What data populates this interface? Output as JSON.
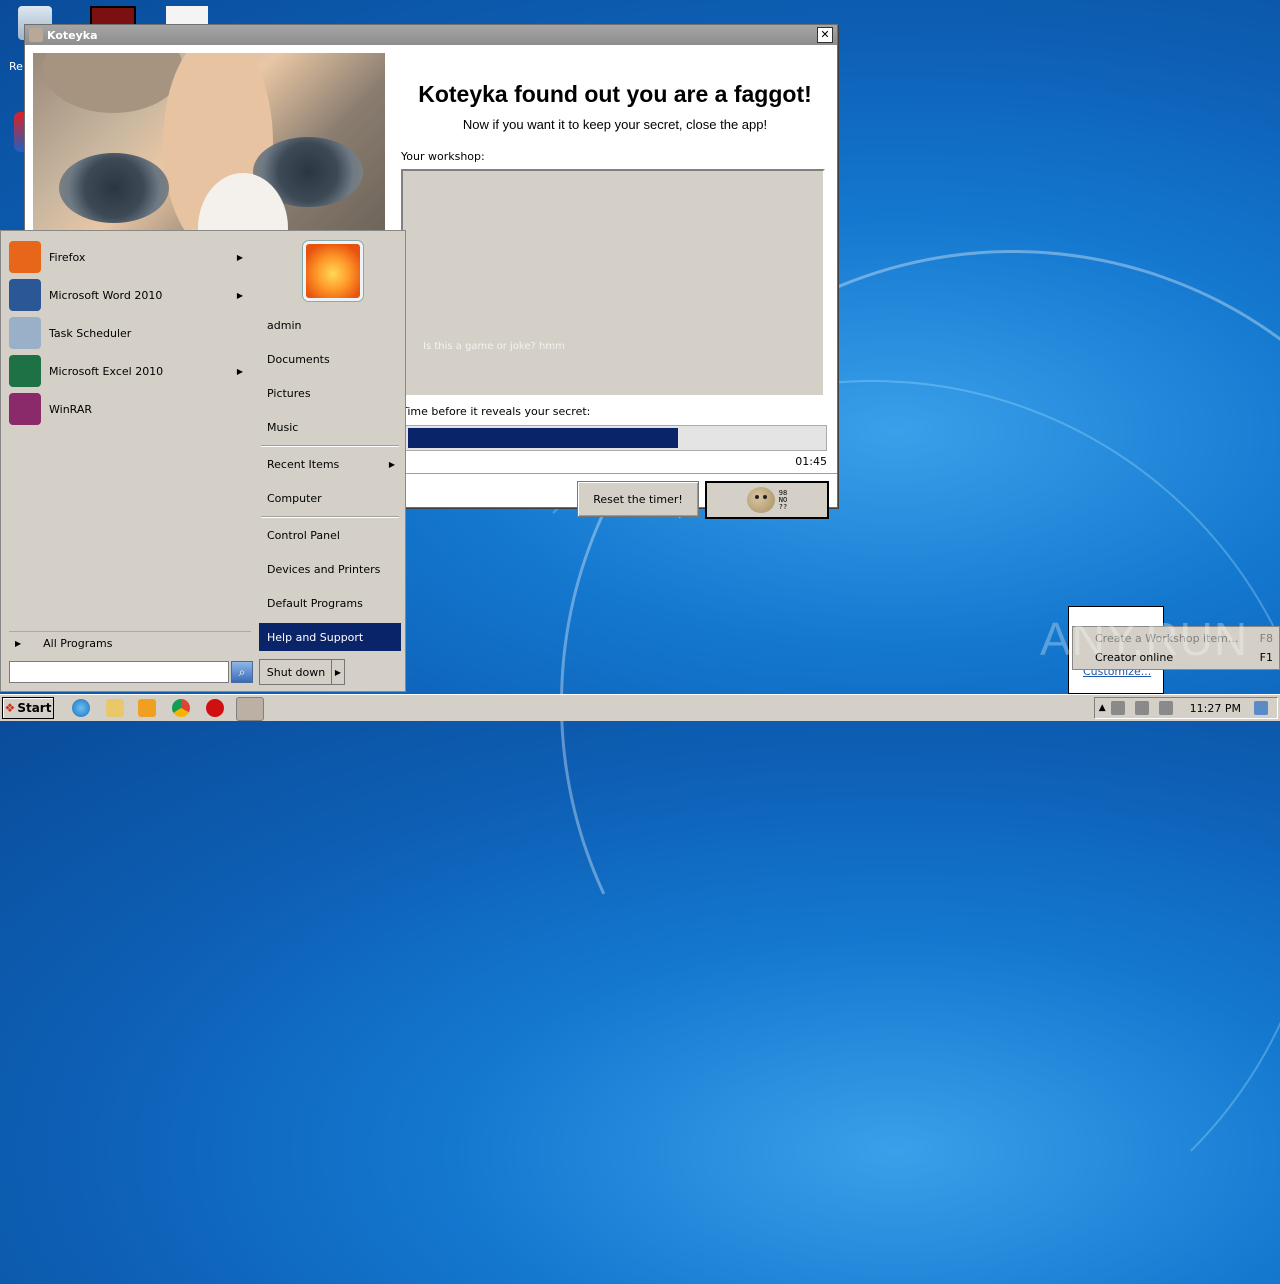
{
  "window": {
    "title": "Koteyka",
    "close_glyph": "✕",
    "headline": "Koteyka found out you are a faggot!",
    "subline": "Now if you want it to keep your secret, close the app!",
    "workshop_label": "Your workshop:",
    "workshop_hint": "Is this a game or joke? hmm",
    "timer_label": "Time before it reveals your secret:",
    "progress_fraction": 0.65,
    "time_remaining": "01:45",
    "reset_button": "Reset the timer!",
    "other_button_glyph": "98\nNO\n??"
  },
  "start_menu": {
    "programs": [
      {
        "label": "Firefox",
        "icon": "firefox-icon",
        "color": "#e8661a",
        "has_arrow": true
      },
      {
        "label": "Microsoft Word 2010",
        "icon": "word-icon",
        "color": "#2b5797",
        "has_arrow": true
      },
      {
        "label": "Task Scheduler",
        "icon": "clock-icon",
        "color": "#9ab0c8",
        "has_arrow": false
      },
      {
        "label": "Microsoft Excel 2010",
        "icon": "excel-icon",
        "color": "#1e7145",
        "has_arrow": true
      },
      {
        "label": "WinRAR",
        "icon": "winrar-icon",
        "color": "#8a2a6a",
        "has_arrow": false
      }
    ],
    "all_programs": "All Programs",
    "right_items": [
      {
        "label": "admin"
      },
      {
        "label": "Documents"
      },
      {
        "label": "Pictures"
      },
      {
        "label": "Music"
      },
      {
        "label": "Recent Items",
        "has_arrow": true
      },
      {
        "label": "Computer"
      },
      {
        "label": "Control Panel"
      },
      {
        "label": "Devices and Printers"
      },
      {
        "label": "Default Programs"
      },
      {
        "label": "Help and Support",
        "active": true
      }
    ],
    "shutdown": "Shut down",
    "arrow_glyph": "▶"
  },
  "tray_popup": {
    "customize": "Customize...",
    "context_items": [
      {
        "label": "Create a Workshop item...",
        "key": "F8",
        "disabled": true
      },
      {
        "label": "Creator online",
        "key": "F1",
        "disabled": false
      }
    ]
  },
  "watermark": "ANY.RUN",
  "taskbar": {
    "start": "Start",
    "clock": "11:27 PM"
  },
  "desktop": {
    "partial_label": "Re"
  }
}
